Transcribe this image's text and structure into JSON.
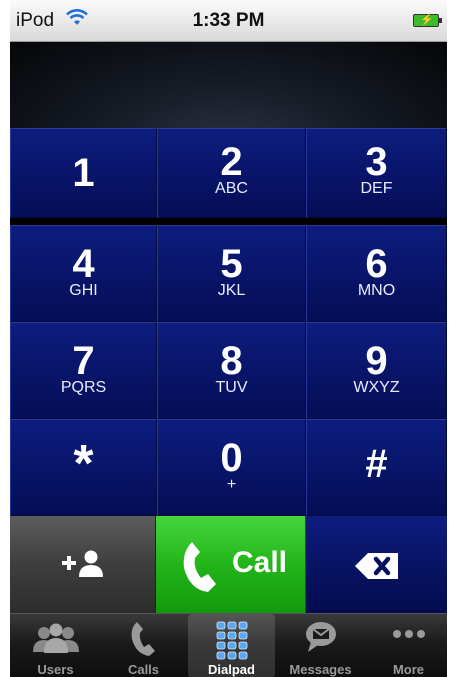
{
  "status_bar": {
    "carrier": "iPod",
    "time": "1:33 PM",
    "battery_state": "charging"
  },
  "display": {
    "number": ""
  },
  "keypad": {
    "keys": [
      {
        "digit": "1",
        "letters": ""
      },
      {
        "digit": "2",
        "letters": "ABC"
      },
      {
        "digit": "3",
        "letters": "DEF"
      },
      {
        "digit": "4",
        "letters": "GHI"
      },
      {
        "digit": "5",
        "letters": "JKL"
      },
      {
        "digit": "6",
        "letters": "MNO"
      },
      {
        "digit": "7",
        "letters": "PQRS"
      },
      {
        "digit": "8",
        "letters": "TUV"
      },
      {
        "digit": "9",
        "letters": "WXYZ"
      },
      {
        "digit": "*",
        "letters": ""
      },
      {
        "digit": "0",
        "letters": "+"
      },
      {
        "digit": "#",
        "letters": ""
      }
    ]
  },
  "actions": {
    "add_contact_icon": "add-contact-icon",
    "call_label": "Call",
    "backspace_icon": "backspace-icon"
  },
  "tabs": [
    {
      "label": "Users",
      "icon": "users-icon"
    },
    {
      "label": "Calls",
      "icon": "phone-icon"
    },
    {
      "label": "Dialpad",
      "icon": "dialpad-icon",
      "active": true
    },
    {
      "label": "Messages",
      "icon": "message-icon"
    },
    {
      "label": "More",
      "icon": "more-icon"
    }
  ],
  "colors": {
    "keypad_blue": "#081468",
    "call_green": "#22b51a",
    "status_bar": "#e8e8e8",
    "tab_bar": "#1b1b1b"
  }
}
